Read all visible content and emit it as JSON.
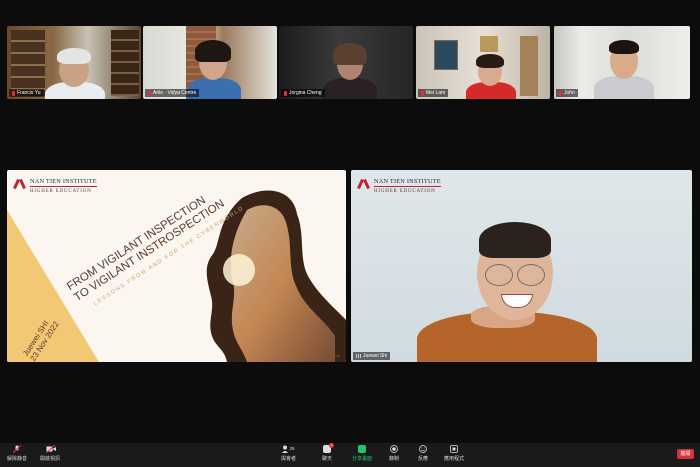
{
  "participants": [
    {
      "name": "Francis Yu",
      "muted": true
    },
    {
      "name": "Arlie · Vidya Centre",
      "muted": true
    },
    {
      "name": "Jorgina Cheng",
      "muted": true
    },
    {
      "name": "Mei Lam",
      "muted": true
    },
    {
      "name": "John",
      "muted": true
    }
  ],
  "slide": {
    "logo_line1": "NAN TIEN INSTITUTE",
    "logo_line2": "HIGHER EDUCATION",
    "title_line1": "FROM VIGILANT INSPECTION",
    "title_line2": "TO VIGILANT INSTROSPECTION",
    "subtitle": "LESSONS FROM AND FOR THE CYBERWORLD",
    "author": "Juewei SHI",
    "date": "23 Nov 2022",
    "page": "01"
  },
  "speaker": {
    "name": "Juewei Shi",
    "logo_line1": "NAN TIEN INSTITUTE",
    "logo_line2": "HIGHER EDUCATION"
  },
  "toolbar": {
    "mute_label": "解除静音",
    "video_label": "開啟視訊",
    "participants_label": "與會者",
    "participants_count": "29",
    "chat_label": "聊天",
    "chat_badge": "1",
    "share_label": "分享畫面",
    "record_label": "錄制",
    "reactions_label": "反應",
    "apps_label": "應用程式",
    "leave_label": "離開"
  },
  "colors": {
    "brand_red": "#c4222e",
    "share_green": "#23c46b",
    "leave_red": "#d9313b"
  }
}
